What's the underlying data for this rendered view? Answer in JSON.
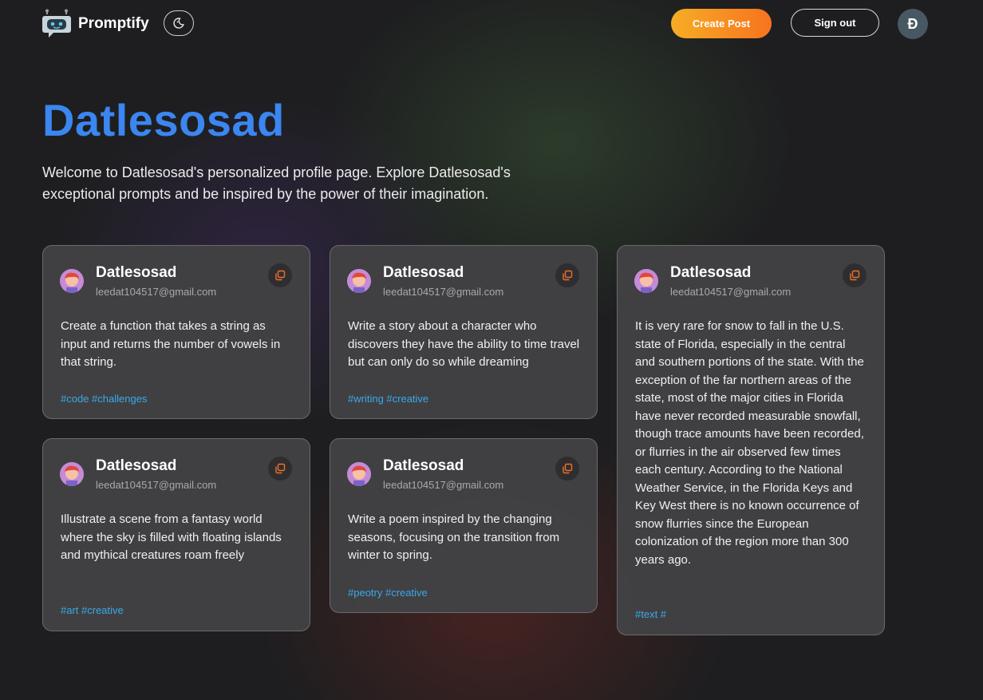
{
  "nav": {
    "brand": "Promptify",
    "create_label": "Create Post",
    "signout_label": "Sign out",
    "avatar_initial": "Đ",
    "icons": {
      "logo": "robot-chat-icon",
      "theme": "moon-toggle-icon"
    },
    "colors": {
      "accent_start": "#f6ad25",
      "accent_end": "#f7731e"
    }
  },
  "profile": {
    "title": "Datlesosad",
    "description": "Welcome to Datlesosad's personalized profile page. Explore Datlesosad's exceptional prompts and be inspired by the power of their imagination.",
    "title_color": "#3b86f0"
  },
  "posts": [
    {
      "username": "Datlesosad",
      "email": "leedat104517@gmail.com",
      "prompt": "Create a function that takes a string as input and returns the number of vowels in that string.",
      "tags": "#code #challenges"
    },
    {
      "username": "Datlesosad",
      "email": "leedat104517@gmail.com",
      "prompt": "Write a story about a character who discovers they have the ability to time travel but can only do so while dreaming",
      "tags": "#writing #creative"
    },
    {
      "username": "Datlesosad",
      "email": "leedat104517@gmail.com",
      "prompt": "It is very rare for snow to fall in the U.S. state of Florida, especially in the central and southern portions of the state. With the exception of the far northern areas of the state, most of the major cities in Florida have never recorded measurable snowfall, though trace amounts have been recorded, or flurries in the air observed few times each century. According to the National Weather Service, in the Florida Keys and Key West there is no known occurrence of snow flurries since the European colonization of the region more than 300 years ago.",
      "tags": "#text #"
    },
    {
      "username": "Datlesosad",
      "email": "leedat104517@gmail.com",
      "prompt": "Illustrate a scene from a fantasy world where the sky is filled with floating islands and mythical creatures roam freely",
      "tags": "#art #creative"
    },
    {
      "username": "Datlesosad",
      "email": "leedat104517@gmail.com",
      "prompt": "Write a poem inspired by the changing seasons, focusing on the transition from winter to spring.",
      "tags": "#peotry #creative"
    }
  ]
}
